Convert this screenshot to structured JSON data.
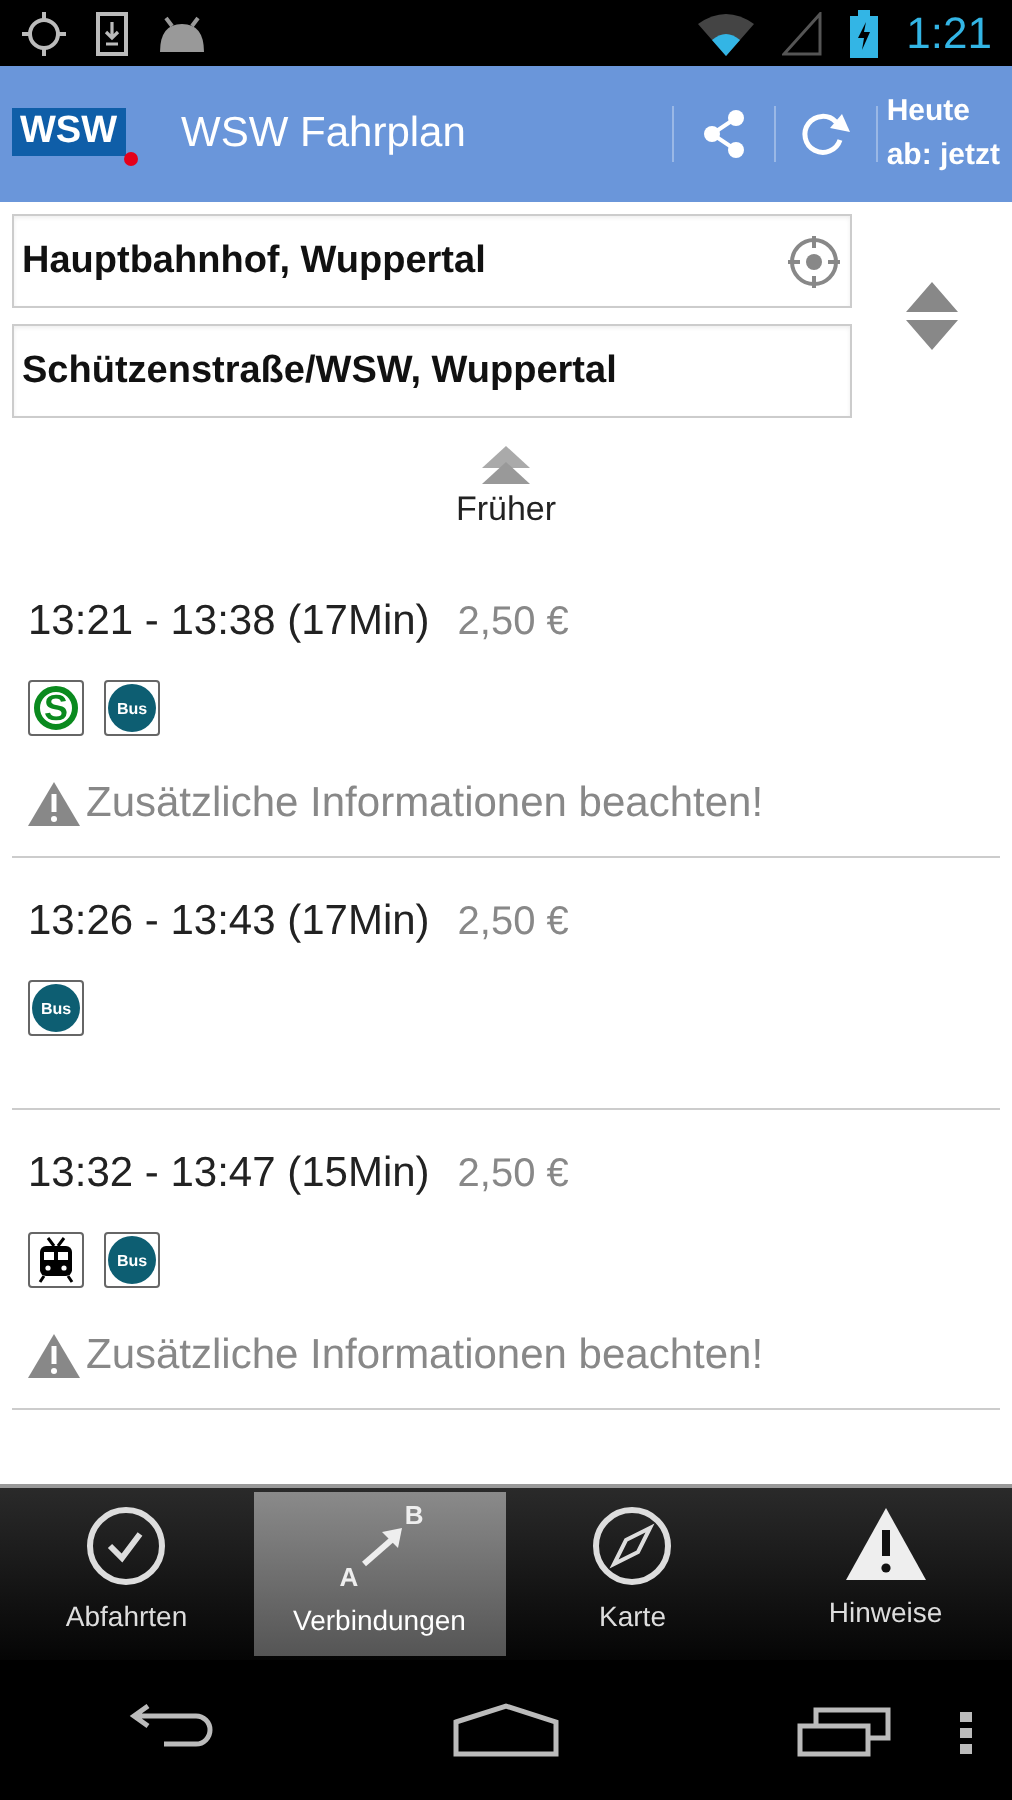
{
  "status_bar": {
    "time": "1:21"
  },
  "app_bar": {
    "logo": "WSW",
    "title": "WSW Fahrplan",
    "date_line": "Heute",
    "time_line": "ab: jetzt"
  },
  "route": {
    "from": "Hauptbahnhof, Wuppertal",
    "to": "Schützenstraße/WSW, Wuppertal"
  },
  "earlier": {
    "label": "Früher"
  },
  "connections": [
    {
      "times": "13:21 - 13:38 (17Min)",
      "price": "2,50 €",
      "legs": [
        {
          "kind": "sbahn",
          "label": "S"
        },
        {
          "kind": "bus",
          "label": "Bus"
        }
      ],
      "notice": "Zusätzliche Informationen beachten!"
    },
    {
      "times": "13:26 - 13:43 (17Min)",
      "price": "2,50 €",
      "legs": [
        {
          "kind": "bus",
          "label": "Bus"
        }
      ]
    },
    {
      "times": "13:32 - 13:47 (15Min)",
      "price": "2,50 €",
      "legs": [
        {
          "kind": "tram"
        },
        {
          "kind": "bus",
          "label": "Bus"
        }
      ],
      "notice": "Zusätzliche Informationen beachten!"
    }
  ],
  "tabs": [
    {
      "kind": "departures",
      "label": "Abfahrten",
      "selected": false
    },
    {
      "kind": "connections",
      "label": "Verbindungen",
      "selected": true,
      "from_mark": "A",
      "to_mark": "B"
    },
    {
      "kind": "map",
      "label": "Karte",
      "selected": false
    },
    {
      "kind": "notices",
      "label": "Hinweise",
      "selected": false
    }
  ]
}
